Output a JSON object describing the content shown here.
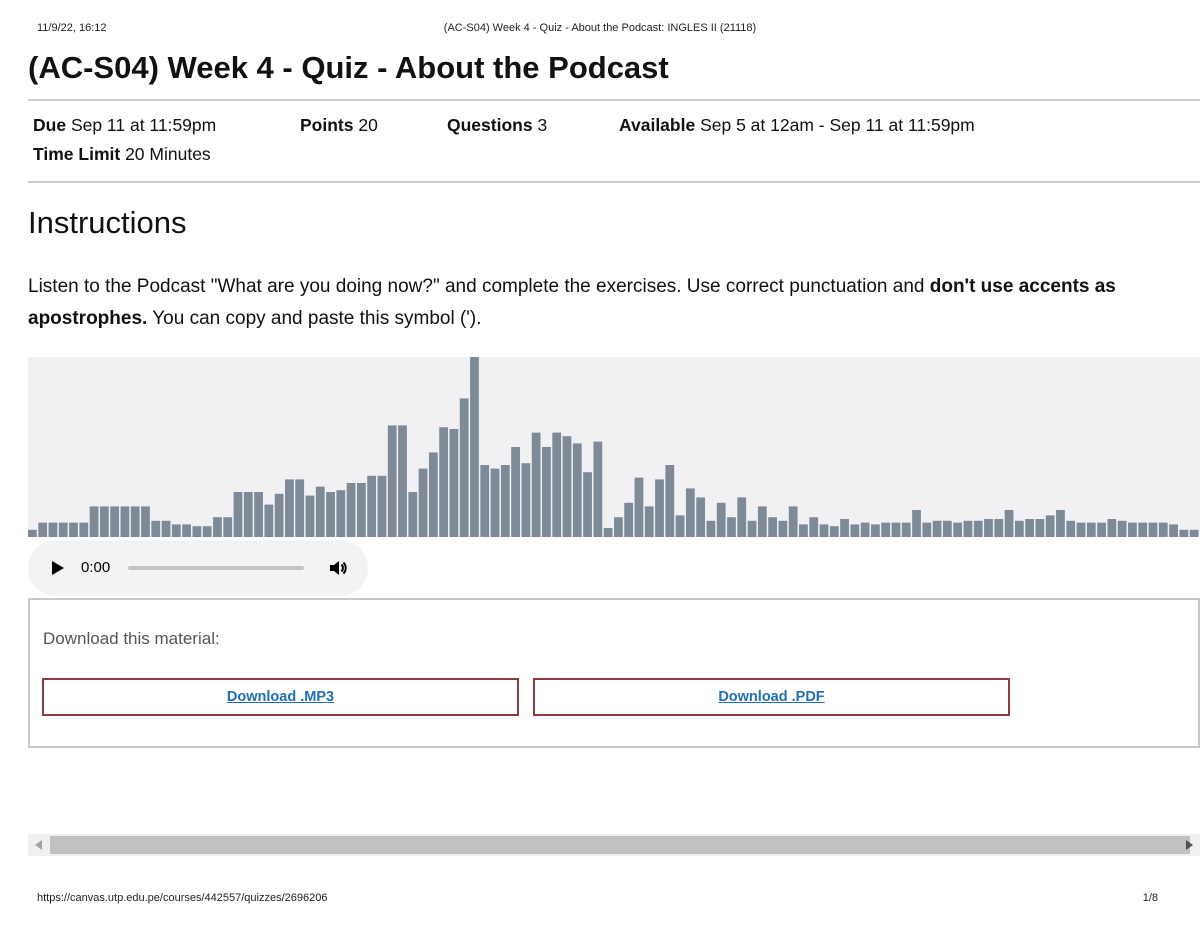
{
  "print_header": {
    "datetime": "11/9/22, 16:12",
    "doc_title": "(AC-S04) Week 4 - Quiz - About the Podcast: INGLES II (21118)"
  },
  "quiz": {
    "title": "(AC-S04) Week 4 - Quiz - About the Podcast",
    "due_label": "Due",
    "due_value": "Sep 11 at 11:59pm",
    "points_label": "Points",
    "points_value": "20",
    "questions_label": "Questions",
    "questions_value": "3",
    "available_label": "Available",
    "available_value": "Sep 5 at 12am - Sep 11 at 11:59pm",
    "time_limit_label": "Time Limit",
    "time_limit_value": "20 Minutes"
  },
  "instructions": {
    "heading": "Instructions",
    "text_1": "Listen to the Podcast \"What are you doing now?\" and complete the exercises. Use correct punctuation and ",
    "text_bold": "don't use accents as apostrophes.",
    "text_2": " You can copy and paste this symbol (')."
  },
  "waveform": {
    "bar_color": "#7f8a99",
    "background": "#f1f1f3",
    "levels": [
      0.04,
      0.08,
      0.08,
      0.08,
      0.08,
      0.08,
      0.17,
      0.17,
      0.17,
      0.17,
      0.17,
      0.17,
      0.09,
      0.09,
      0.07,
      0.07,
      0.06,
      0.06,
      0.11,
      0.11,
      0.25,
      0.25,
      0.25,
      0.18,
      0.24,
      0.32,
      0.32,
      0.23,
      0.28,
      0.25,
      0.26,
      0.3,
      0.3,
      0.34,
      0.34,
      0.62,
      0.62,
      0.25,
      0.38,
      0.47,
      0.61,
      0.6,
      0.77,
      1.0,
      0.4,
      0.38,
      0.4,
      0.5,
      0.41,
      0.58,
      0.5,
      0.58,
      0.56,
      0.52,
      0.36,
      0.53,
      0.05,
      0.11,
      0.19,
      0.33,
      0.17,
      0.32,
      0.4,
      0.12,
      0.27,
      0.22,
      0.09,
      0.19,
      0.11,
      0.22,
      0.09,
      0.17,
      0.11,
      0.09,
      0.17,
      0.07,
      0.11,
      0.07,
      0.06,
      0.1,
      0.07,
      0.08,
      0.07,
      0.08,
      0.08,
      0.08,
      0.15,
      0.08,
      0.09,
      0.09,
      0.08,
      0.09,
      0.09,
      0.1,
      0.1,
      0.15,
      0.09,
      0.1,
      0.1,
      0.12,
      0.15,
      0.09,
      0.08,
      0.08,
      0.08,
      0.1,
      0.09,
      0.08,
      0.08,
      0.08,
      0.08,
      0.07,
      0.04,
      0.04
    ]
  },
  "audio": {
    "time": "0:00",
    "progress": 0
  },
  "download": {
    "label": "Download this material:",
    "mp3": "Download .MP3",
    "pdf": "Download .PDF",
    "border_color": "#8c3a3f",
    "link_color": "#1f6fb2"
  },
  "footer": {
    "url": "https://canvas.utp.edu.pe/courses/442557/quizzes/2696206",
    "page": "1/8"
  }
}
